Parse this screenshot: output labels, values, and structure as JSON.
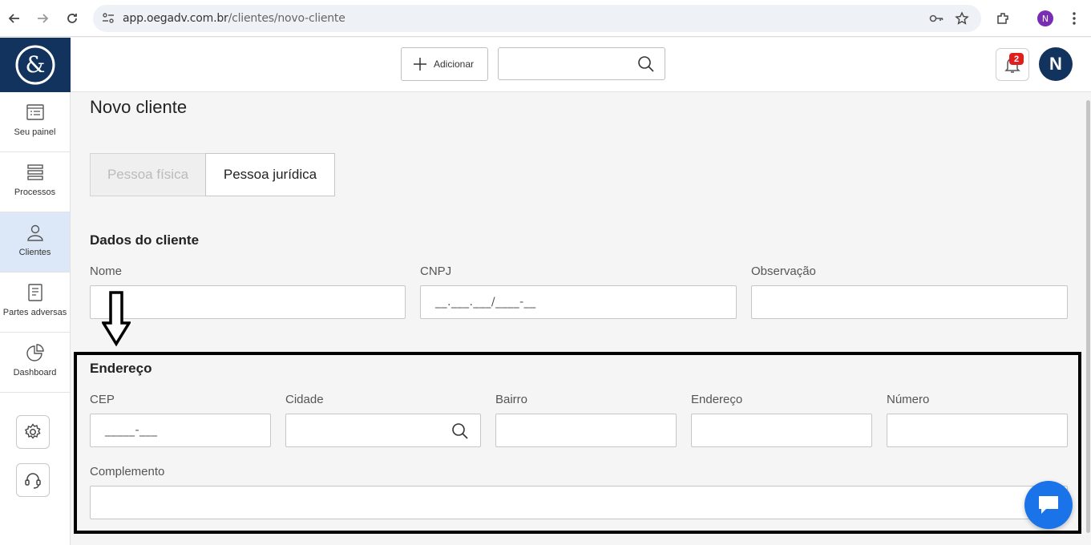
{
  "browser": {
    "url_domain": "app.oegadv.com.br",
    "url_path": "/clientes/novo-cliente",
    "profile_initial": "N",
    "icons": [
      "back-icon",
      "forward-icon",
      "reload-icon",
      "site-settings-icon",
      "key-icon",
      "star-icon",
      "extensions-icon",
      "menu-icon"
    ]
  },
  "header": {
    "add_label": "Adicionar",
    "search_placeholder": "",
    "notification_count": "2",
    "avatar_initial": "N"
  },
  "sidebar": {
    "items": [
      {
        "label": "Seu painel",
        "icon": "dashboard-list-icon"
      },
      {
        "label": "Processos",
        "icon": "stack-icon"
      },
      {
        "label": "Clientes",
        "icon": "user-icon",
        "active": true
      },
      {
        "label": "Partes adversas",
        "icon": "document-icon"
      },
      {
        "label": "Dashboard",
        "icon": "pie-chart-icon"
      }
    ],
    "bottom_icons": [
      "settings-icon",
      "support-headset-icon"
    ]
  },
  "page": {
    "title": "Novo cliente",
    "person_type": {
      "option_fisica": "Pessoa física",
      "option_juridica": "Pessoa jurídica",
      "selected": "Pessoa jurídica"
    }
  },
  "client_data": {
    "section_title": "Dados do cliente",
    "nome_label": "Nome",
    "nome_value": "",
    "cnpj_label": "CNPJ",
    "cnpj_mask": "__.___.___/____-__",
    "observacao_label": "Observação",
    "observacao_value": ""
  },
  "address": {
    "section_title": "Endereço",
    "cep_label": "CEP",
    "cep_mask": "_____-___",
    "cidade_label": "Cidade",
    "bairro_label": "Bairro",
    "endereco_label": "Endereço",
    "numero_label": "Número",
    "complemento_label": "Complemento"
  },
  "colors": {
    "brand_navy": "#13335f",
    "active_sidebar": "#dce7f7",
    "chat_blue": "#1a73e8",
    "badge_red": "#e01e1e"
  }
}
